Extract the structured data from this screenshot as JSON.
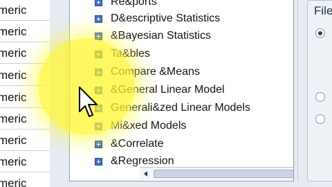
{
  "left_list": {
    "rows": [
      "meric",
      "meric",
      "meric",
      "meric",
      "meric",
      "meric",
      "meric",
      "meric",
      "meric"
    ]
  },
  "tree": {
    "items": [
      {
        "label": "Re&ports"
      },
      {
        "label": "D&escriptive Statistics"
      },
      {
        "label": "&Bayesian Statistics"
      },
      {
        "label": "Ta&bles"
      },
      {
        "label": "Compare &Means"
      },
      {
        "label": "&General Linear Model"
      },
      {
        "label": "Generali&zed Linear Models"
      },
      {
        "label": "Mi&xed Models"
      },
      {
        "label": "&Correlate"
      },
      {
        "label": "&Regression"
      }
    ]
  },
  "right_group": {
    "title": "File"
  },
  "colors": {
    "accent": "#3d6fbf",
    "highlight": "#fff528"
  }
}
